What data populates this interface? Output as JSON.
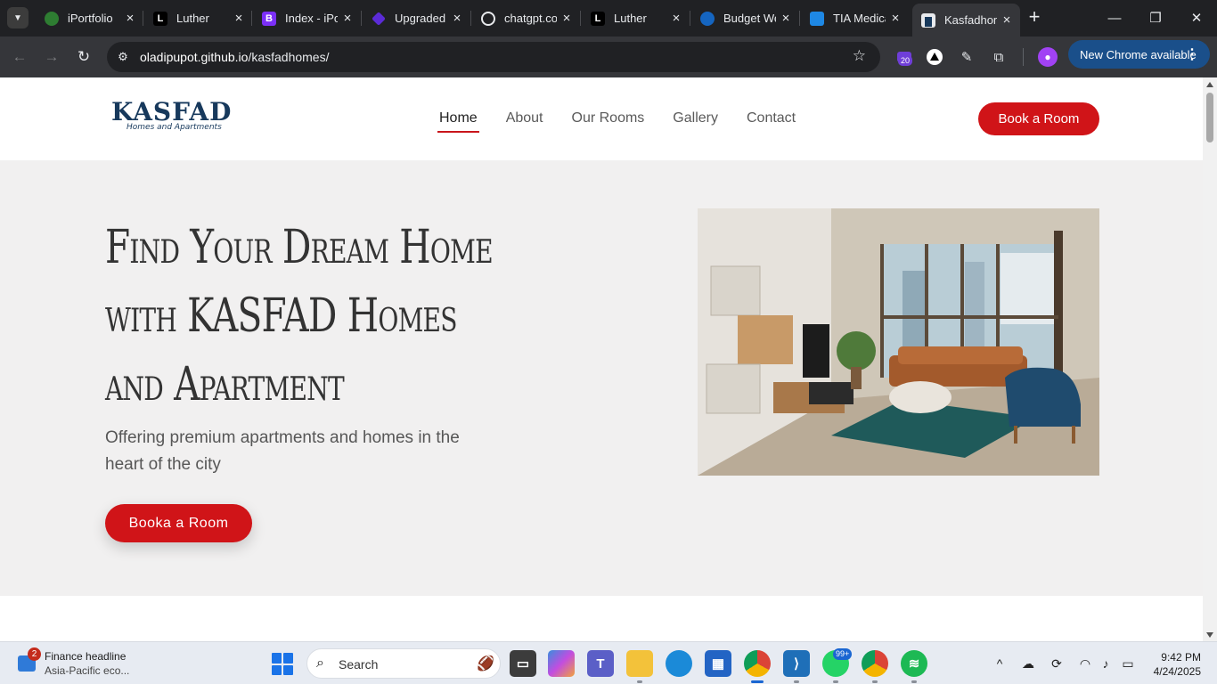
{
  "browser": {
    "tabs": [
      {
        "title": "iPortfolio",
        "favicon_color": "#2e7d32",
        "icon": "globe-icon"
      },
      {
        "title": "Luther",
        "favicon_color": "#000000",
        "icon": "letter-l-icon",
        "glyph": "L"
      },
      {
        "title": "Index - iPortfolio",
        "favicon_color": "#7b2ff7",
        "icon": "bootstrap-icon",
        "glyph": "B"
      },
      {
        "title": "Upgraded",
        "favicon_color": "#5b2bd6",
        "icon": "diamond-icon"
      },
      {
        "title": "chatgpt.com",
        "favicon_color": "#3c3c3c",
        "icon": "openai-icon"
      },
      {
        "title": "Luther",
        "favicon_color": "#000000",
        "icon": "letter-l-icon",
        "glyph": "L"
      },
      {
        "title": "Budget Web",
        "favicon_color": "#1565c0",
        "icon": "shield-icon"
      },
      {
        "title": "TIA Medical",
        "favicon_color": "#1e88e5",
        "icon": "tia-icon"
      },
      {
        "title": "Kasfadhomes",
        "favicon_color": "#17395c",
        "icon": "building-icon",
        "active": true
      }
    ],
    "url_host": "oladipupot.github.io",
    "url_path": "/kasfadhomes/",
    "extension_badge": "20",
    "new_chrome_label": "New Chrome available",
    "window_controls": {
      "minimize": "—",
      "restore": "❐",
      "close": "✕"
    }
  },
  "site": {
    "brand": "KASFAD",
    "tagline": "Homes and Apartments",
    "nav": [
      {
        "label": "Home",
        "active": true
      },
      {
        "label": "About"
      },
      {
        "label": "Our Rooms"
      },
      {
        "label": "Gallery"
      },
      {
        "label": "Contact"
      }
    ],
    "header_cta": "Book a Room",
    "accent_color": "#d01418",
    "brand_color": "#17395c"
  },
  "hero": {
    "heading": "Find Your Dream Home with KASFAD Homes and Apartment",
    "subtitle": "Offering premium apartments and homes in the heart of the city",
    "cta": "Booka a Room",
    "image_description": "living-room-photo"
  },
  "taskbar": {
    "news_title": "Finance headline",
    "news_subtitle": "Asia-Pacific eco...",
    "news_badge": "2",
    "search_label": "Search",
    "whatsapp_badge": "99+",
    "time": "9:42 PM",
    "date": "4/24/2025"
  }
}
